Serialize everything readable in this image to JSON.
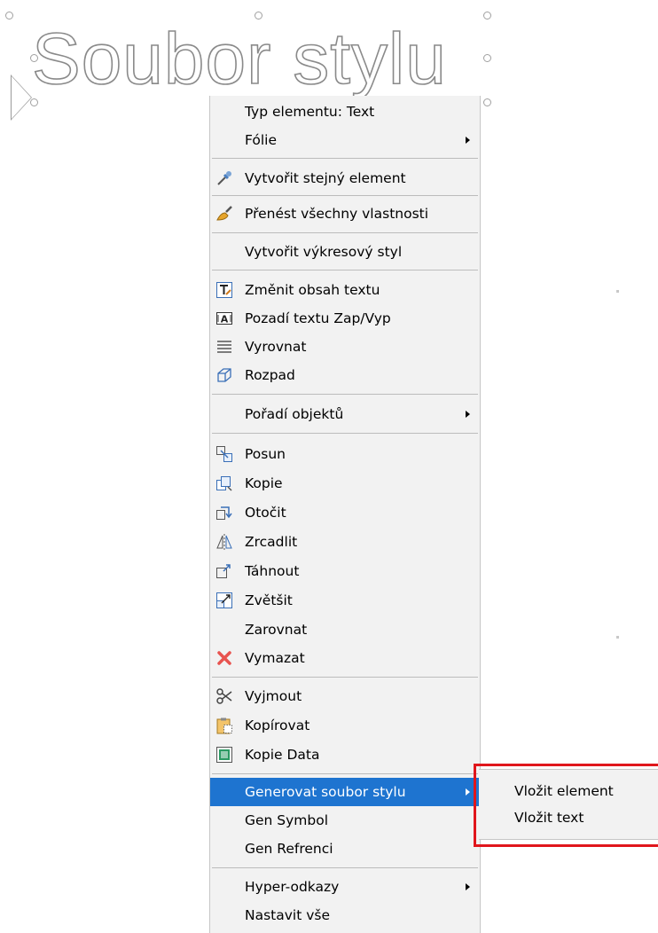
{
  "canvas": {
    "text": "Soubor stylu"
  },
  "context_menu": {
    "items": [
      {
        "label": "Typ elementu: Text",
        "icon": ""
      },
      {
        "label": "Fólie",
        "icon": "",
        "submenu": true
      },
      {
        "label": "Vytvořit stejný element",
        "icon": "eyedropper-icon"
      },
      {
        "label": "Přenést všechny vlastnosti",
        "icon": "brush-icon"
      },
      {
        "label": "Vytvořit výkresový styl",
        "icon": ""
      },
      {
        "label": "Změnit obsah textu",
        "icon": "edit-text-icon"
      },
      {
        "label": "Pozadí textu Zap/Vyp",
        "icon": "text-background-icon"
      },
      {
        "label": "Vyrovnat",
        "icon": "align-lines-icon"
      },
      {
        "label": "Rozpad",
        "icon": "explode-icon"
      },
      {
        "label": "Pořadí objektů",
        "icon": "",
        "submenu": true
      },
      {
        "label": "Posun",
        "icon": "move-icon"
      },
      {
        "label": "Kopie",
        "icon": "copy-object-icon"
      },
      {
        "label": "Otočit",
        "icon": "rotate-icon"
      },
      {
        "label": "Zrcadlit",
        "icon": "mirror-icon"
      },
      {
        "label": "Táhnout",
        "icon": "stretch-icon"
      },
      {
        "label": "Zvětšit",
        "icon": "scale-icon"
      },
      {
        "label": "Zarovnat",
        "icon": ""
      },
      {
        "label": "Vymazat",
        "icon": "delete-icon"
      },
      {
        "label": "Vyjmout",
        "icon": "cut-icon"
      },
      {
        "label": "Kopírovat",
        "icon": "clipboard-icon"
      },
      {
        "label": "Kopie Data",
        "icon": "copy-data-icon"
      },
      {
        "label": "Generovat soubor stylu",
        "icon": "",
        "submenu": true,
        "highlighted": true
      },
      {
        "label": "Gen Symbol",
        "icon": ""
      },
      {
        "label": "Gen Refrenci",
        "icon": ""
      },
      {
        "label": "Hyper-odkazy",
        "icon": "",
        "submenu": true
      },
      {
        "label": "Nastavit vše",
        "icon": ""
      }
    ]
  },
  "submenu": {
    "items": [
      {
        "label": "Vložit element"
      },
      {
        "label": "Vložit text"
      }
    ]
  },
  "colors": {
    "highlight": "#1e74d0",
    "annotation": "#e0161c",
    "delete_icon": "#e8534f"
  }
}
